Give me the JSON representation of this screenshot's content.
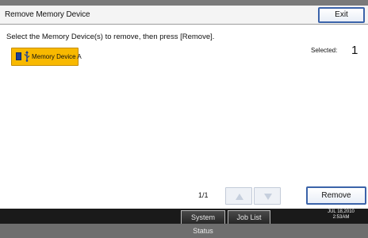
{
  "window": {
    "title": "Remove Memory Device",
    "exit_label": "Exit"
  },
  "main": {
    "instruction": "Select the Memory Device(s) to remove, then press [Remove].",
    "devices": [
      {
        "label": "Memory Device A",
        "selected": true
      }
    ],
    "selected_label": "Selected:",
    "selected_count": "1"
  },
  "pagination": {
    "page": "1/1",
    "up_icon": "triangle-up-icon",
    "down_icon": "triangle-down-icon"
  },
  "actions": {
    "remove_label": "Remove"
  },
  "bottom_bar": {
    "system_status_label": "System Status",
    "job_list_label": "Job List",
    "date": "JUL  18,2010",
    "time": "2:53AM"
  },
  "colors": {
    "accent": "#3b63a9",
    "selected_device": "#f8b900",
    "bottom_bar": "#1a1a1a"
  }
}
